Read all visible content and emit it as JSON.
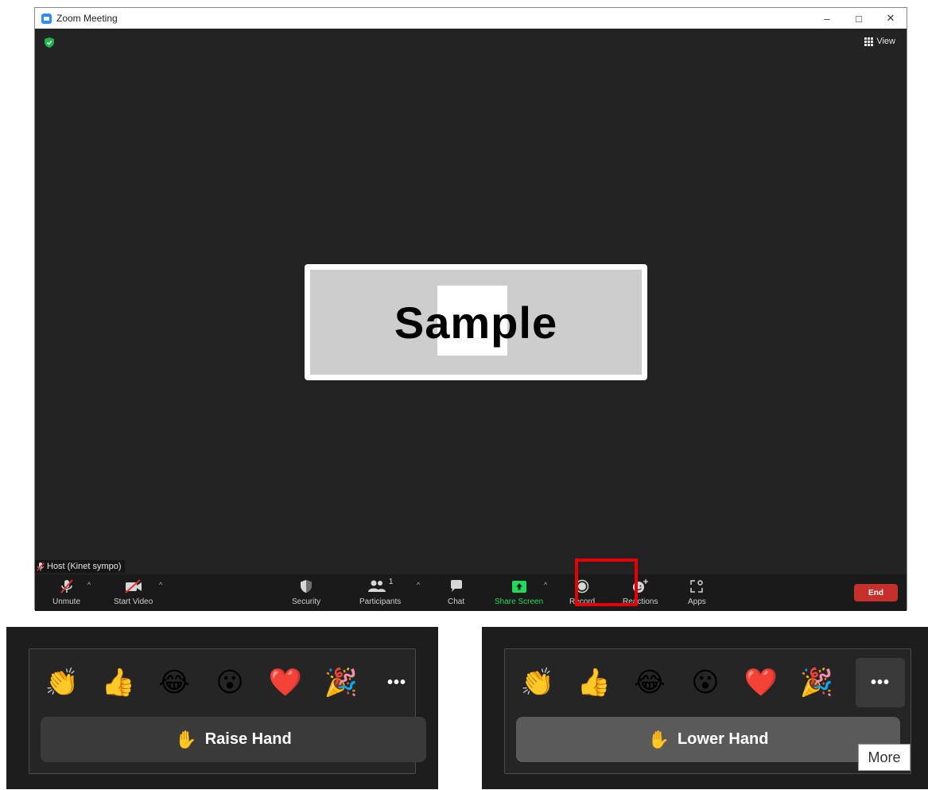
{
  "window": {
    "title": "Zoom Meeting",
    "controls": {
      "minimize": "–",
      "maximize": "□",
      "close": "✕"
    }
  },
  "stage": {
    "view_label": "View",
    "sample_text": "Sample",
    "host_label": "Host (Kinet sympo)"
  },
  "toolbar": {
    "unmute": "Unmute",
    "start_video": "Start Video",
    "security": "Security",
    "participants": "Participants",
    "participants_count": "1",
    "chat": "Chat",
    "share_screen": "Share Screen",
    "record": "Record",
    "reactions": "Reactions",
    "apps": "Apps",
    "end": "End",
    "caret": "^"
  },
  "reactions_popup_left": {
    "emojis": [
      "👏",
      "👍",
      "😂",
      "😮",
      "❤️",
      "🎉"
    ],
    "more": "•••",
    "hand_icon": "✋",
    "hand_label": "Raise Hand"
  },
  "reactions_popup_right": {
    "emojis": [
      "👏",
      "👍",
      "😂",
      "😮",
      "❤️",
      "🎉"
    ],
    "more": "•••",
    "hand_icon": "✋",
    "hand_label": "Lower Hand",
    "tooltip": "More"
  },
  "colors": {
    "accent_blue": "#2d8cff",
    "share_green": "#23d959",
    "end_red": "#c6302b",
    "highlight_red": "#e60000",
    "security_green": "#23b14d"
  }
}
